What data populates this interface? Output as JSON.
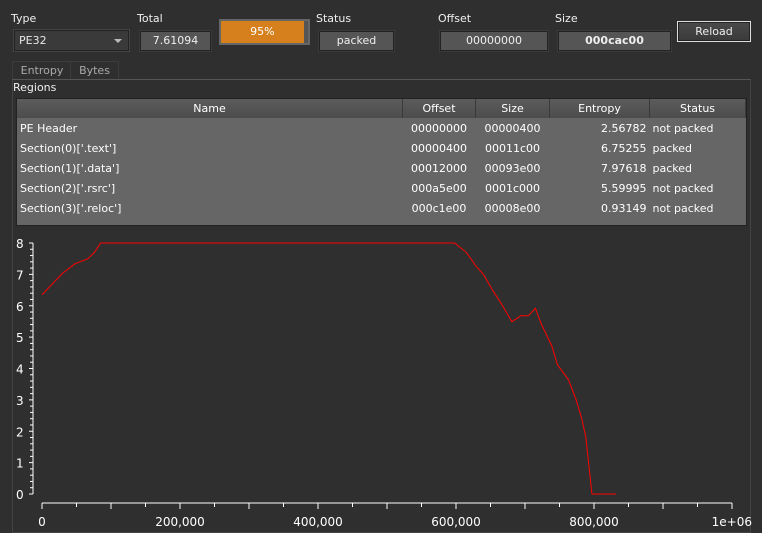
{
  "toolbar": {
    "type_label": "Type",
    "type_value": "PE32",
    "total_label": "Total",
    "total_value": "7.61094",
    "progress": {
      "percent": 95,
      "text": "95%",
      "color": "#d5801c"
    },
    "status_label": "Status",
    "status_value": "packed",
    "offset_label": "Offset",
    "offset_value": "00000000",
    "size_label": "Size",
    "size_value": "000cac00",
    "reload_label": "Reload"
  },
  "tabs": [
    {
      "label": "Entropy",
      "active": true
    },
    {
      "label": "Bytes",
      "active": false
    }
  ],
  "regions": {
    "title": "Regions",
    "columns": [
      "Name",
      "Offset",
      "Size",
      "Entropy",
      "Status"
    ],
    "rows": [
      [
        "PE Header",
        "00000000",
        "00000400",
        "2.56782",
        "not packed"
      ],
      [
        "Section(0)['.text']",
        "00000400",
        "00011c00",
        "6.75255",
        "packed"
      ],
      [
        "Section(1)['.data']",
        "00012000",
        "00093e00",
        "7.97618",
        "packed"
      ],
      [
        "Section(2)['.rsrc']",
        "000a5e00",
        "0001c000",
        "5.59995",
        "not packed"
      ],
      [
        "Section(3)['.reloc']",
        "000c1e00",
        "00008e00",
        "0.93149",
        "not packed"
      ]
    ]
  },
  "chart_data": {
    "type": "line",
    "xlim": [
      0,
      1000000
    ],
    "ylim": [
      0,
      8
    ],
    "x_ticks": [
      "0",
      "200,000",
      "400,000",
      "600,000",
      "800,000",
      "1e+06"
    ],
    "y_ticks": [
      "0",
      "1",
      "2",
      "3",
      "4",
      "5",
      "6",
      "7",
      "8"
    ],
    "grid": false,
    "line_color": "#ff0000",
    "points": [
      [
        0,
        6.35
      ],
      [
        9000,
        6.56
      ],
      [
        30000,
        7.04
      ],
      [
        48000,
        7.34
      ],
      [
        66000,
        7.49
      ],
      [
        76000,
        7.7
      ],
      [
        85000,
        8.0
      ],
      [
        598000,
        8.0
      ],
      [
        615000,
        7.7
      ],
      [
        629000,
        7.26
      ],
      [
        640000,
        6.99
      ],
      [
        654000,
        6.46
      ],
      [
        665000,
        6.09
      ],
      [
        681000,
        5.49
      ],
      [
        694000,
        5.68
      ],
      [
        705000,
        5.68
      ],
      [
        715000,
        5.92
      ],
      [
        724000,
        5.4
      ],
      [
        739000,
        4.71
      ],
      [
        747000,
        4.12
      ],
      [
        754000,
        3.91
      ],
      [
        763000,
        3.64
      ],
      [
        774000,
        3.01
      ],
      [
        782000,
        2.42
      ],
      [
        788000,
        1.84
      ],
      [
        797000,
        0
      ],
      [
        832000,
        0
      ]
    ]
  }
}
